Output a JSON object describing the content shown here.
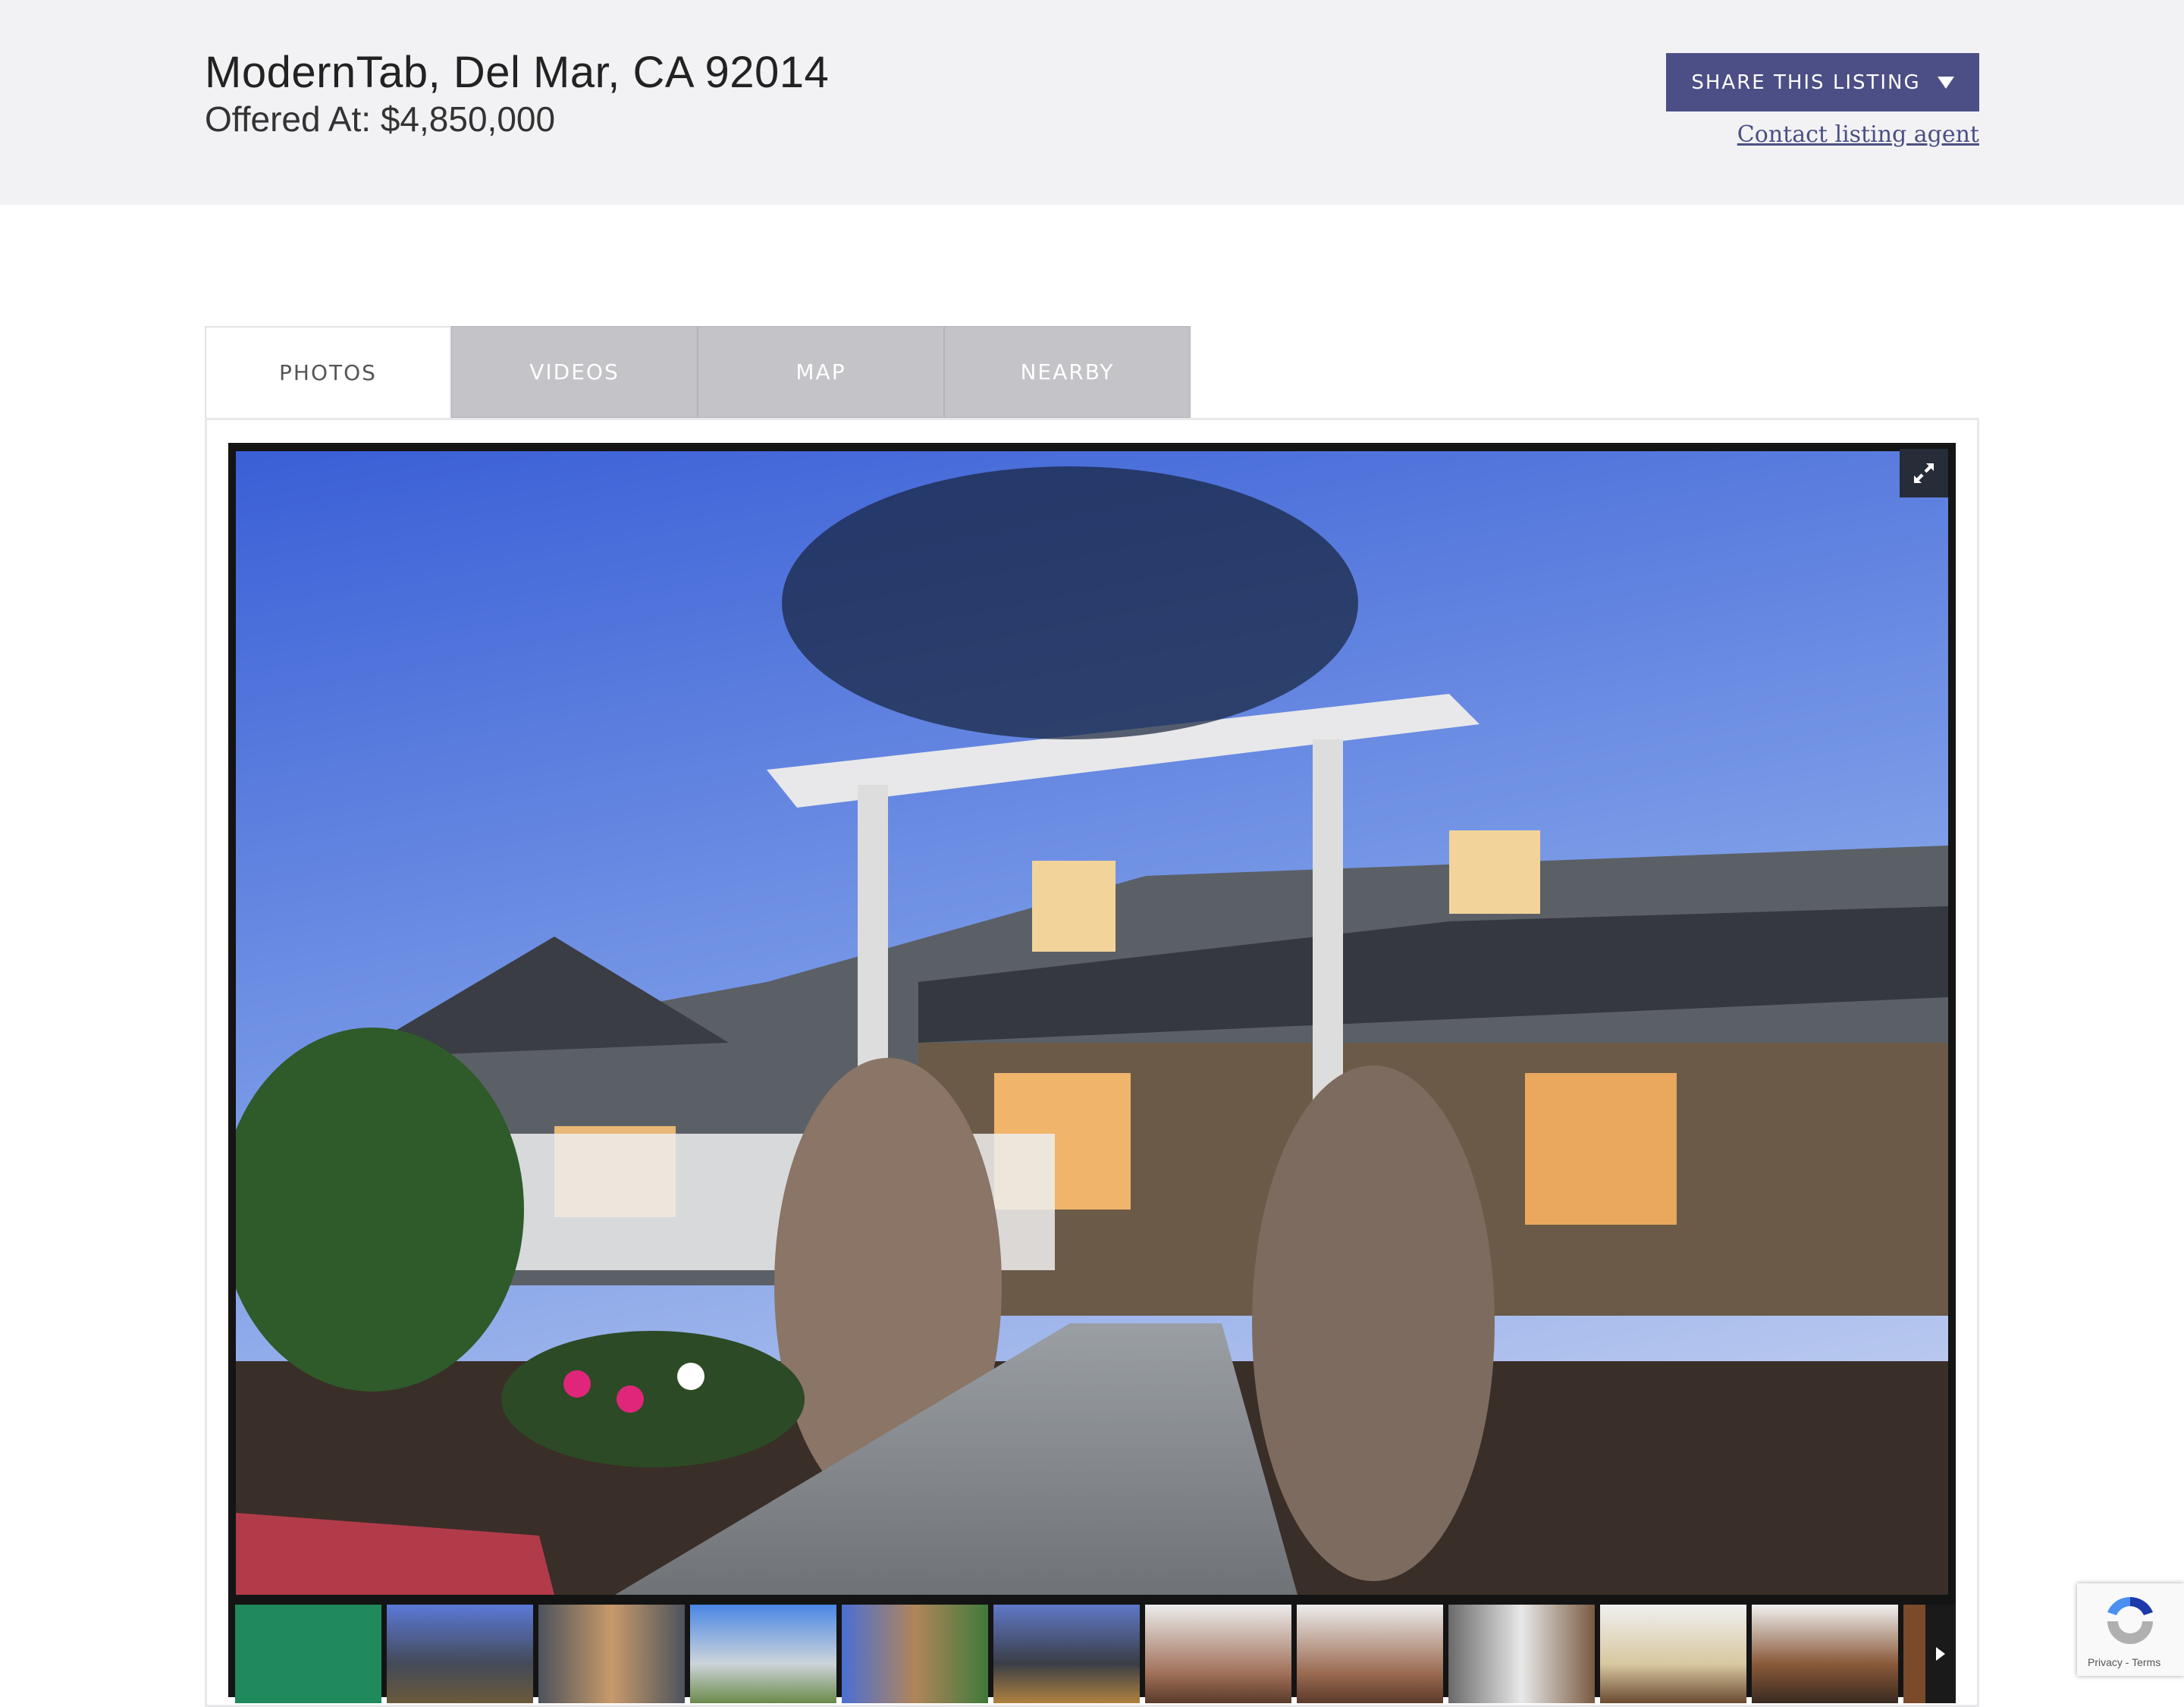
{
  "header": {
    "title": "ModernTab, Del Mar, CA 92014",
    "price": "Offered At: $4,850,000",
    "share_label": "SHARE THIS LISTING",
    "contact_label": "Contact listing agent"
  },
  "colors": {
    "accent": "#4b4f85",
    "header_bg": "#f2f2f4",
    "tab_inactive": "#c3c3c8"
  },
  "tabs": [
    {
      "label": "PHOTOS",
      "active": true
    },
    {
      "label": "VIDEOS"
    },
    {
      "label": "MAP"
    },
    {
      "label": "NEARBY"
    }
  ],
  "gallery": {
    "expand_icon": "expand-arrows-icon",
    "thumbnail_count_visible": 12,
    "next_icon": "chevron-right-icon"
  },
  "recaptcha": {
    "text": "Privacy - Terms"
  }
}
